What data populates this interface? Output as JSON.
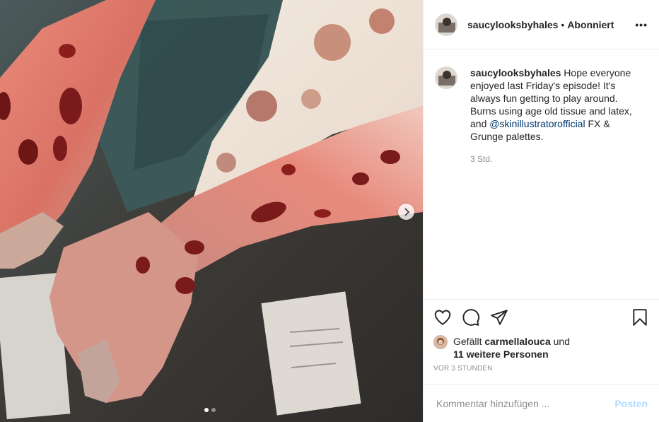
{
  "post": {
    "media": {
      "image_alt": "Special effects makeup of burn wounds on two forearms and hands",
      "carousel": {
        "count": 2,
        "current": 1
      },
      "next_icon": "chevron-right-icon"
    },
    "header": {
      "username": "saucylooksbyhales",
      "separator": "•",
      "follow_status": "Abonniert",
      "more_icon": "more-horizontal-icon",
      "more_label": "•••"
    },
    "caption": {
      "username": "saucylooksbyhales",
      "text_before": "Hope everyone enjoyed last Friday's episode! It's always fun getting to play around. Burns using age old tissue and latex, and ",
      "mention": "@skinillustratorofficial",
      "text_after": " FX & Grunge palettes.",
      "relative_time": "3 Std."
    },
    "actions": {
      "like_icon": "heart-icon",
      "comment_icon": "comment-icon",
      "share_icon": "paper-plane-icon",
      "save_icon": "bookmark-icon"
    },
    "likes": {
      "prefix": "Gefällt ",
      "liker": "carmellalouca",
      "conjunction": " und",
      "others": "11 weitere Personen"
    },
    "timestamp": "VOR 3 STUNDEN",
    "comment_input": {
      "placeholder": "Kommentar hinzufügen ...",
      "value": ""
    },
    "post_button": "Posten",
    "colors": {
      "link": "#00376b",
      "muted": "#8e8e8e",
      "post_button_disabled": "#b3dbff"
    }
  }
}
